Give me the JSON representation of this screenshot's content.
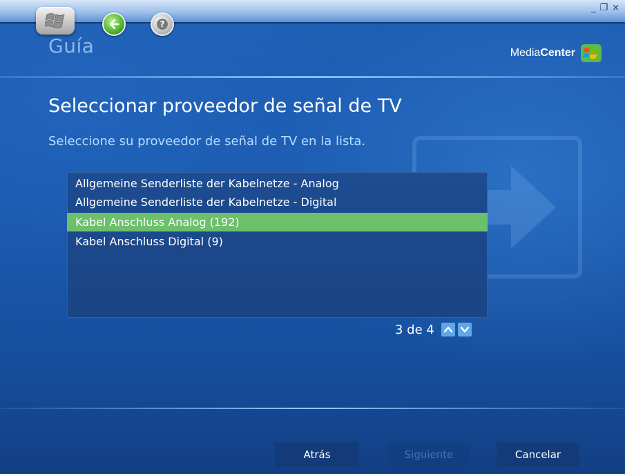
{
  "window": {
    "controls": [
      "_",
      "❐",
      "×"
    ]
  },
  "header": {
    "section_title": "Guía",
    "brand_prefix": "Media",
    "brand_bold": "Center"
  },
  "page": {
    "title": "Seleccionar proveedor de señal de TV",
    "subtitle": "Seleccione su proveedor de señal de TV en la lista."
  },
  "provider_list": {
    "items": [
      {
        "label": "Allgemeine Senderliste der Kabelnetze - Analog",
        "selected": false
      },
      {
        "label": "Allgemeine Senderliste der Kabelnetze - Digital",
        "selected": false
      },
      {
        "label": "Kabel Anschluss Analog (192)",
        "selected": true
      },
      {
        "label": "Kabel Anschluss Digital (9)",
        "selected": false
      }
    ],
    "pager_text": "3 de 4"
  },
  "footer": {
    "back_label": "Atrás",
    "next_label": "Siguiente",
    "cancel_label": "Cancelar"
  },
  "colors": {
    "background": "#1a59ae",
    "selection": "#6cc06c",
    "accent": "#5fa7e6",
    "disabled_text": "#3e74b8"
  },
  "icons": [
    "windows-logo-icon",
    "back-arrow-icon",
    "help-icon",
    "minimize-icon",
    "restore-icon",
    "close-icon",
    "media-center-logo-icon",
    "chevron-up-icon",
    "chevron-down-icon"
  ]
}
